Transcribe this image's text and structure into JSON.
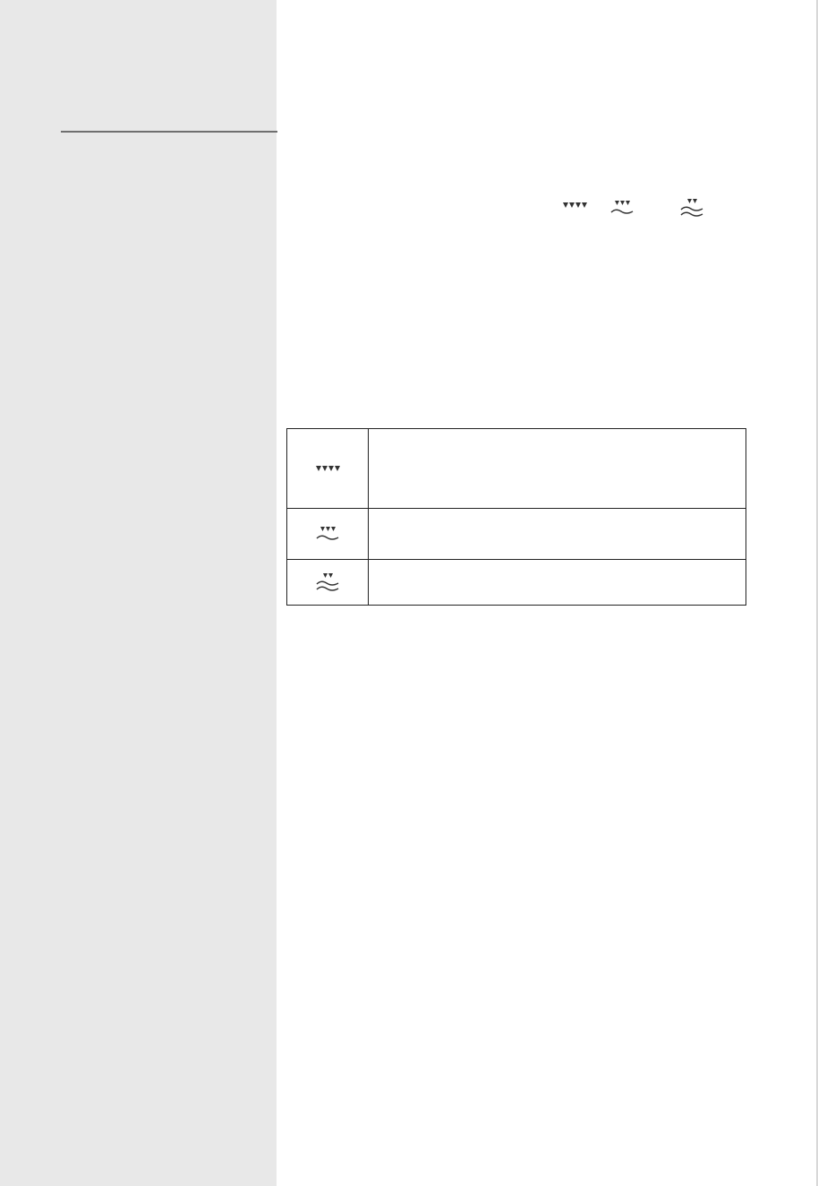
{
  "legend": {
    "rows": [
      {
        "icon": "water-level-4-drops-icon",
        "text": ""
      },
      {
        "icon": "water-level-3-drops-wave-icon",
        "text": ""
      },
      {
        "icon": "water-level-2-drops-double-wave-icon",
        "text": ""
      }
    ]
  },
  "inline_symbols": [
    "water-level-4-drops-icon",
    "water-level-3-drops-wave-icon",
    "water-level-2-drops-double-wave-icon"
  ],
  "colors": {
    "sidebar": "#e8e8e8",
    "rule": "#6f6f6f",
    "icon": "#333333",
    "border": "#222222"
  }
}
